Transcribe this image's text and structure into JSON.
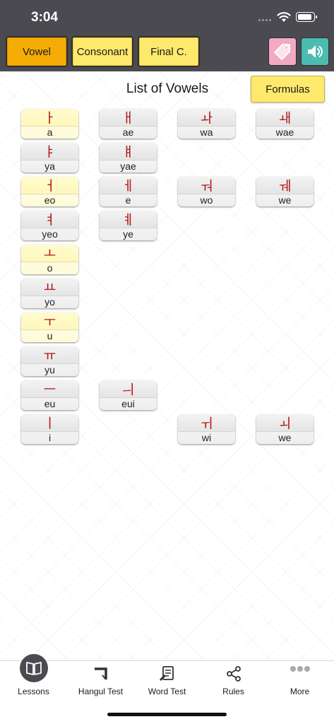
{
  "status": {
    "time": "3:04"
  },
  "header": {
    "tabs": [
      {
        "label": "Vowel",
        "active": true
      },
      {
        "label": "Consonant",
        "active": false
      },
      {
        "label": "Final C.",
        "active": false
      }
    ],
    "icons": [
      "tag-icon",
      "speaker-icon"
    ]
  },
  "main": {
    "title": "List of Vowels",
    "formulas_label": "Formulas",
    "vowels": [
      {
        "glyph": "ㅏ",
        "roman": "a",
        "basic": true
      },
      {
        "glyph": "ㅐ",
        "roman": "ae",
        "basic": false
      },
      {
        "glyph": "ㅘ",
        "roman": "wa",
        "basic": false
      },
      {
        "glyph": "ㅙ",
        "roman": "wae",
        "basic": false
      },
      {
        "glyph": "ㅑ",
        "roman": "ya",
        "basic": false
      },
      {
        "glyph": "ㅒ",
        "roman": "yae",
        "basic": false
      },
      {
        "glyph": "ㅓ",
        "roman": "eo",
        "basic": true
      },
      {
        "glyph": "ㅔ",
        "roman": "e",
        "basic": false
      },
      {
        "glyph": "ㅝ",
        "roman": "wo",
        "basic": false
      },
      {
        "glyph": "ㅞ",
        "roman": "we",
        "basic": false
      },
      {
        "glyph": "ㅕ",
        "roman": "yeo",
        "basic": false
      },
      {
        "glyph": "ㅖ",
        "roman": "ye",
        "basic": false
      },
      {
        "glyph": "ㅗ",
        "roman": "o",
        "basic": true
      },
      {
        "glyph": "ㅛ",
        "roman": "yo",
        "basic": false
      },
      {
        "glyph": "ㅜ",
        "roman": "u",
        "basic": true
      },
      {
        "glyph": "ㅠ",
        "roman": "yu",
        "basic": false
      },
      {
        "glyph": "ㅡ",
        "roman": "eu",
        "basic": false
      },
      {
        "glyph": "ㅢ",
        "roman": "eui",
        "basic": false
      },
      {
        "glyph": "ㅣ",
        "roman": "i",
        "basic": false
      },
      {
        "glyph": "ㅟ",
        "roman": "wi",
        "basic": false
      },
      {
        "glyph": "ㅚ",
        "roman": "we",
        "basic": false
      }
    ]
  },
  "tabbar": {
    "items": [
      {
        "label": "Lessons",
        "icon": "book-icon"
      },
      {
        "label": "Hangul Test",
        "icon": "hangul-test-icon"
      },
      {
        "label": "Word Test",
        "icon": "word-test-icon"
      },
      {
        "label": "Rules",
        "icon": "share-icon"
      },
      {
        "label": "More",
        "icon": "more-icon"
      }
    ]
  },
  "colors": {
    "header_bg": "#4a4a50",
    "tab_active": "#f5ad05",
    "tab_inactive": "#fde96b",
    "glyph_red": "#b01818",
    "tag_pink": "#f2a9c4",
    "sound_teal": "#4dbcb0"
  }
}
